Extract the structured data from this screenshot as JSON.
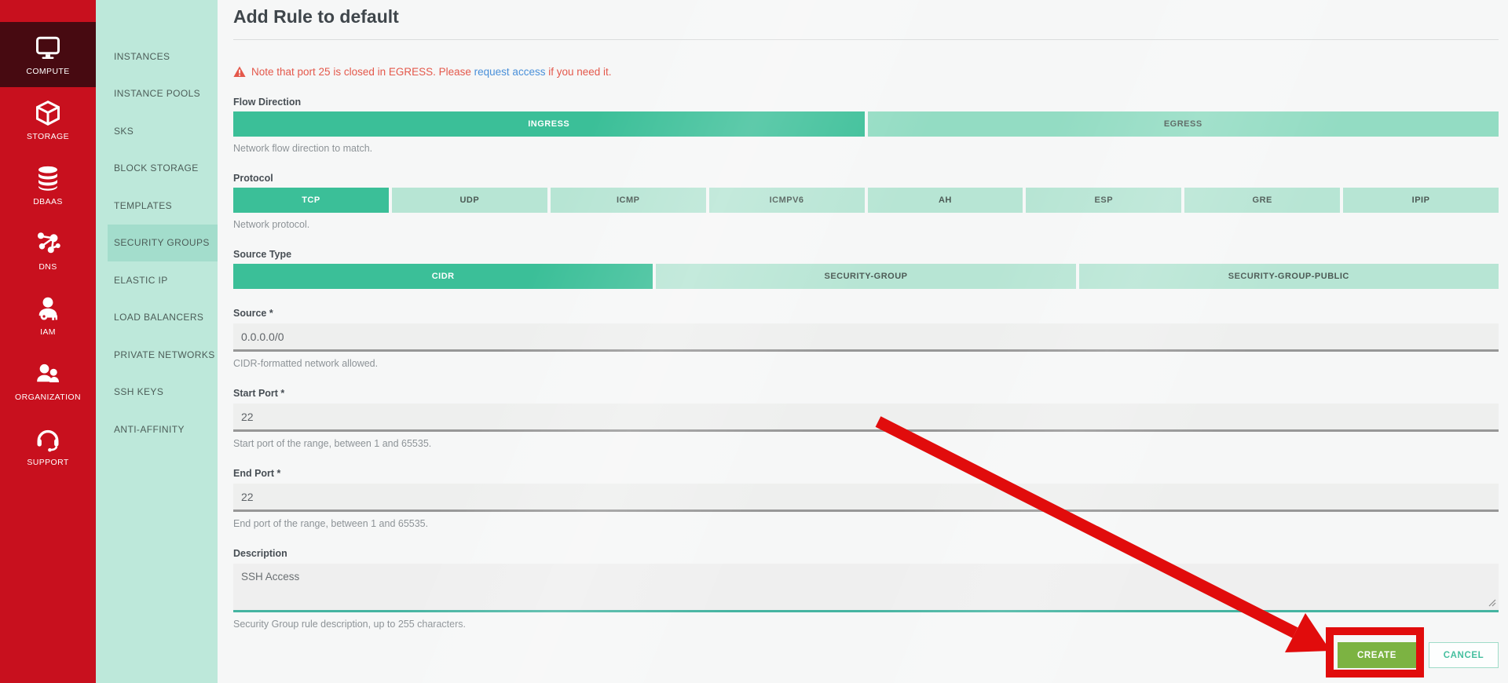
{
  "colors": {
    "brand_red": "#c8101e",
    "nav_active_bg": "#470a11",
    "submenu_bg": "#bde8da",
    "submenu_active_bg": "#a3ddcc",
    "accent_teal": "#3bbf98",
    "segment_unselected": "#b7e5d4",
    "segment_unselected_flow": "#93dcc3",
    "create_green": "#7cb342",
    "cancel_teal": "#45bf9f",
    "warning_red": "#e4584b",
    "link_blue": "#4a90d9",
    "annotation_red": "#e10c0c"
  },
  "nav_rail": {
    "items": [
      {
        "label": "COMPUTE",
        "icon": "monitor-icon",
        "active": true
      },
      {
        "label": "STORAGE",
        "icon": "cube-icon",
        "active": false
      },
      {
        "label": "DBAAS",
        "icon": "database-icon",
        "active": false
      },
      {
        "label": "DNS",
        "icon": "network-nodes-icon",
        "active": false
      },
      {
        "label": "IAM",
        "icon": "user-key-icon",
        "active": false
      },
      {
        "label": "ORGANIZATION",
        "icon": "people-icon",
        "active": false
      },
      {
        "label": "SUPPORT",
        "icon": "headset-icon",
        "active": false
      }
    ]
  },
  "submenu": {
    "items": [
      {
        "label": "INSTANCES",
        "active": false
      },
      {
        "label": "INSTANCE POOLS",
        "active": false
      },
      {
        "label": "SKS",
        "active": false
      },
      {
        "label": "BLOCK STORAGE",
        "active": false
      },
      {
        "label": "TEMPLATES",
        "active": false
      },
      {
        "label": "SECURITY GROUPS",
        "active": true
      },
      {
        "label": "ELASTIC IP",
        "active": false
      },
      {
        "label": "LOAD BALANCERS",
        "active": false
      },
      {
        "label": "PRIVATE NETWORKS",
        "active": false
      },
      {
        "label": "SSH KEYS",
        "active": false
      },
      {
        "label": "ANTI-AFFINITY",
        "active": false
      }
    ]
  },
  "page": {
    "title": "Add Rule to default",
    "warning_prefix": "Note that port 25 is closed in EGRESS. Please ",
    "warning_link": "request access",
    "warning_suffix": " if you need it."
  },
  "form": {
    "flow_direction": {
      "label": "Flow Direction",
      "options": [
        "INGRESS",
        "EGRESS"
      ],
      "selected": "INGRESS",
      "help": "Network flow direction to match."
    },
    "protocol": {
      "label": "Protocol",
      "options": [
        "TCP",
        "UDP",
        "ICMP",
        "ICMPV6",
        "AH",
        "ESP",
        "GRE",
        "IPIP"
      ],
      "selected": "TCP",
      "help": "Network protocol."
    },
    "source_type": {
      "label": "Source Type",
      "options": [
        "CIDR",
        "SECURITY-GROUP",
        "SECURITY-GROUP-PUBLIC"
      ],
      "selected": "CIDR"
    },
    "source": {
      "label": "Source *",
      "value": "0.0.0.0/0",
      "help": "CIDR-formatted network allowed."
    },
    "start_port": {
      "label": "Start Port *",
      "value": "22",
      "help": "Start port of the range, between 1 and 65535."
    },
    "end_port": {
      "label": "End Port *",
      "value": "22",
      "help": "End port of the range, between 1 and 65535."
    },
    "description": {
      "label": "Description",
      "value": "SSH Access",
      "help": "Security Group rule description, up to 255 characters."
    }
  },
  "actions": {
    "create": "CREATE",
    "cancel": "CANCEL"
  }
}
